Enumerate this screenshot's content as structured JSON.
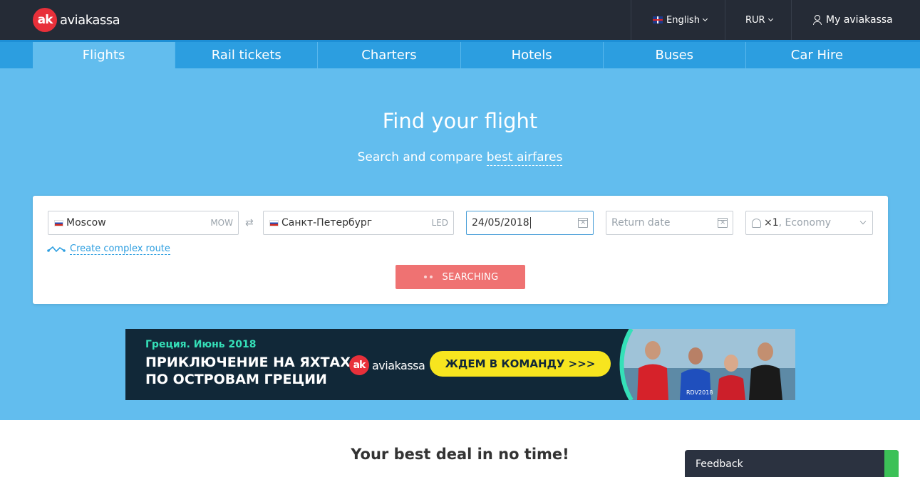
{
  "header": {
    "logo_mark": "ak",
    "logo_text": "aviakassa",
    "language": "English",
    "currency": "RUR",
    "account": "My aviakassa"
  },
  "nav": {
    "tabs": [
      {
        "label": "Flights",
        "active": true
      },
      {
        "label": "Rail tickets",
        "active": false
      },
      {
        "label": "Charters",
        "active": false
      },
      {
        "label": "Hotels",
        "active": false
      },
      {
        "label": "Buses",
        "active": false
      },
      {
        "label": "Car Hire",
        "active": false
      }
    ]
  },
  "hero": {
    "title": "Find your flight",
    "subtitle_prefix": "Search and compare ",
    "subtitle_link": "best airfares"
  },
  "search": {
    "origin_city": "Moscow",
    "origin_code": "MOW",
    "destination_city": "Санкт-Петербург",
    "destination_code": "LED",
    "depart_date": "24/05/2018",
    "return_placeholder": "Return date",
    "passengers": "×1",
    "cabin_class": ", Economy",
    "complex_route": "Create complex route",
    "search_button": "SEARCHING"
  },
  "banner": {
    "small": "Греция. Июнь 2018",
    "line1": "ПРИКЛЮЧЕНИЕ НА ЯХТАХ",
    "line2": "ПО ОСТРОВАМ ГРЕЦИИ",
    "logo_text": "aviakassa",
    "cta": "ЖДЕМ В КОМАНДУ >>>",
    "shirt_text": "RDV2018"
  },
  "section": {
    "deal_title": "Your best deal in no time!"
  },
  "feedback": {
    "label": "Feedback"
  },
  "colors": {
    "topbar": "#252b36",
    "nav": "#2c9ee0",
    "hero": "#62bdee",
    "search_button": "#ef7272",
    "banner_bg": "#112838",
    "banner_cta": "#f7e51f",
    "banner_accent": "#35e0b8",
    "brand_red": "#e8303a"
  }
}
